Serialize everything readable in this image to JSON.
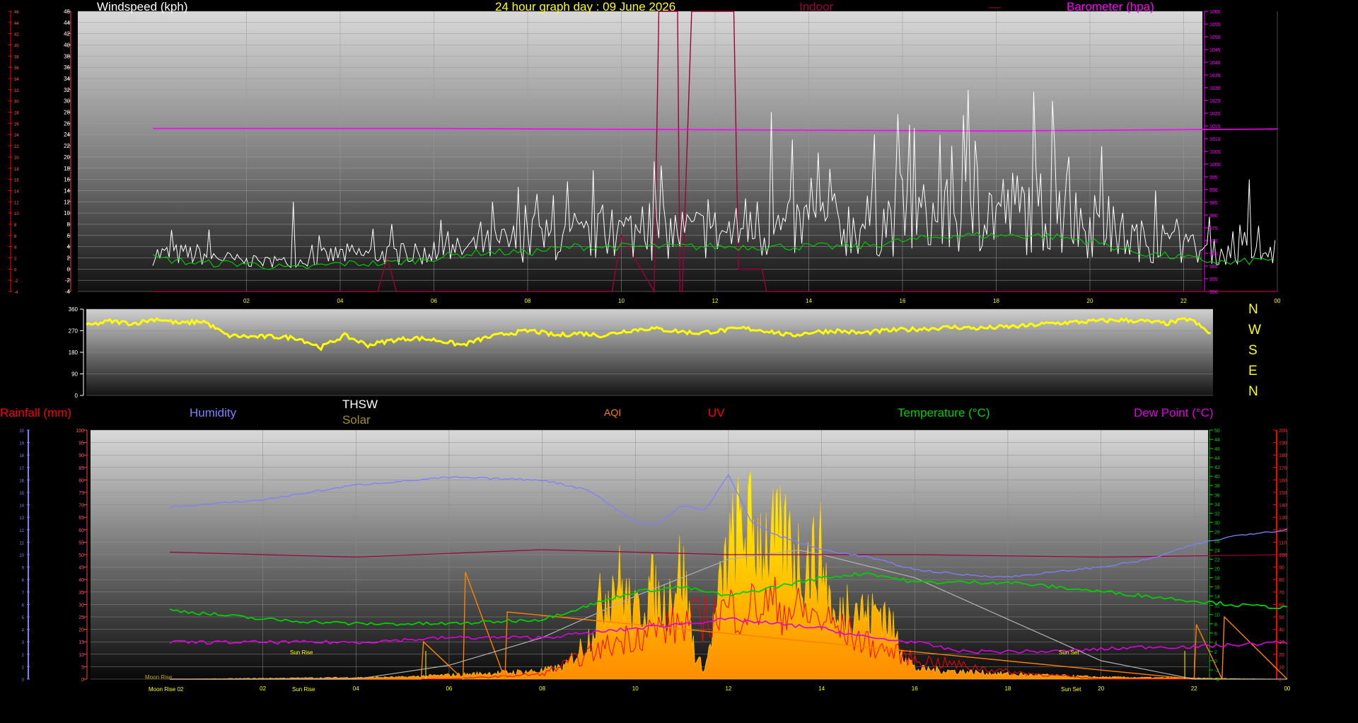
{
  "header": {
    "windspeed_label": "Windspeed (kph)",
    "title": "24 hour graph day : 09 June 2026",
    "indoor_label": "Indoor",
    "indoor_legend_mark": "—",
    "barometer_label": "Barometer (hpa)"
  },
  "direction_compass": [
    "N",
    "W",
    "S",
    "E",
    "N"
  ],
  "legend": {
    "rainfall": "Rainfall (mm)",
    "humidity": "Humidity",
    "thsw": "THSW",
    "solar": "Solar",
    "aqi": "AQI",
    "uv": "UV",
    "temperature": "Temperature (°C)",
    "dew_point": "Dew Point (°C)"
  },
  "annotations": {
    "moon_rise_axis": "Moon Rise 02",
    "moon_rise_plot": "Moon Rise",
    "sun_rise_axis": "Sun Rise",
    "sun_rise_plot": "Sun Rise",
    "sun_set_axis": "Sun Set",
    "sun_set_plot": "Sun Set"
  },
  "colors": {
    "windspeed": "#ffffff",
    "wind_avg": "#00c800",
    "barometer": "#ff00ff",
    "indoor": "#a0003c",
    "direction": "#ffff00",
    "humidity": "#7f7fff",
    "temperature": "#00d000",
    "dew_point": "#e000e0",
    "solar": "#ffd700",
    "uv": "#ff0000",
    "aqi": "#ff8000",
    "rainfall": "#ff0000",
    "thsw": "#b0b0b0"
  },
  "chart_data": [
    {
      "type": "line",
      "panel": "wind",
      "x_ticks": [
        "02",
        "04",
        "06",
        "08",
        "10",
        "12",
        "14",
        "16",
        "18",
        "20",
        "22",
        "00"
      ],
      "left_axis": {
        "label": "Windspeed (kph)",
        "ylim": [
          -4,
          46
        ],
        "ticks": [
          "-4",
          "-2",
          "0",
          "2",
          "4",
          "6",
          "8",
          "10",
          "12",
          "14",
          "16",
          "18",
          "20",
          "22",
          "24",
          "26",
          "28",
          "30",
          "32",
          "34",
          "36",
          "38",
          "40",
          "42",
          "44",
          "46"
        ]
      },
      "right_axis": {
        "label": "Barometer (hpa)",
        "ylim": [
          950,
          1060
        ],
        "ticks": [
          "950",
          "955",
          "960",
          "965",
          "970",
          "975",
          "980",
          "985",
          "990",
          "995",
          "1000",
          "1005",
          "1010",
          "1015",
          "1020",
          "1025",
          "1030",
          "1035",
          "1040",
          "1045",
          "1050",
          "1055",
          "1060"
        ]
      },
      "series": [
        {
          "name": "Windspeed (kph)",
          "color": "#ffffff",
          "x": [
            0,
            1,
            2,
            3,
            4,
            5,
            6,
            7,
            8,
            9,
            10,
            11,
            12,
            13,
            14,
            15,
            16,
            17,
            18,
            19,
            20,
            21,
            22,
            23,
            24
          ],
          "y": [
            4,
            4,
            2,
            2,
            4,
            4,
            4,
            6,
            8,
            8,
            10,
            10,
            10,
            10,
            12,
            12,
            14,
            14,
            16,
            16,
            12,
            8,
            6,
            4,
            4
          ],
          "peaks": [
            [
              3.0,
              12
            ],
            [
              9.0,
              10
            ],
            [
              13.2,
              28
            ],
            [
              15.4,
              24
            ],
            [
              17.4,
              32
            ],
            [
              19.2,
              30
            ],
            [
              21.4,
              14
            ],
            [
              23.4,
              16
            ]
          ]
        },
        {
          "name": "Wind average",
          "color": "#00c800",
          "x": [
            0,
            1,
            2,
            3,
            4,
            5,
            6,
            7,
            8,
            9,
            10,
            11,
            12,
            13,
            14,
            15,
            16,
            17,
            18,
            19,
            20,
            21,
            22,
            23,
            24
          ],
          "y": [
            2,
            1,
            1,
            0,
            1,
            1,
            2,
            3,
            3,
            4,
            4,
            4,
            4,
            4,
            4,
            4,
            5,
            6,
            6,
            6,
            5,
            3,
            2,
            1,
            2
          ]
        },
        {
          "name": "Barometer (hpa)",
          "axis": "right",
          "color": "#ff00ff",
          "x": [
            0,
            6,
            12,
            18,
            24
          ],
          "y": [
            1014,
            1014,
            1013.5,
            1013,
            1013.8
          ]
        },
        {
          "name": "Indoor",
          "color": "#a0003c",
          "x": [
            0,
            4.8,
            5.0,
            5.2,
            9.8,
            10.0,
            10.7,
            10.8,
            11.2,
            11.25,
            11.3,
            11.5,
            12.4,
            12.5,
            13.0,
            13.1,
            24
          ],
          "y": [
            -4,
            -4,
            2,
            -4,
            -4,
            6,
            -4,
            46,
            46,
            -4,
            -4,
            46,
            46,
            0,
            0,
            -4,
            -4
          ]
        }
      ]
    },
    {
      "type": "line",
      "panel": "direction",
      "ylim": [
        0,
        360
      ],
      "y_ticks": [
        "0",
        "90",
        "180",
        "270",
        "360"
      ],
      "series": [
        {
          "name": "Wind direction",
          "color": "#ffff00",
          "x": [
            0,
            0.5,
            1,
            1.5,
            2,
            2.5,
            3,
            3.5,
            4,
            4.5,
            5,
            5.5,
            6,
            6.5,
            7,
            7.5,
            8,
            8.5,
            9,
            9.5,
            10,
            10.5,
            11,
            11.5,
            12,
            12.5,
            13,
            13.5,
            14,
            14.5,
            15,
            15.5,
            16,
            16.5,
            17,
            17.5,
            18,
            18.5,
            19,
            19.5,
            20,
            20.5,
            21,
            21.5,
            22,
            22.5,
            23,
            23.5,
            24
          ],
          "y": [
            290,
            310,
            300,
            320,
            300,
            310,
            250,
            245,
            245,
            240,
            200,
            250,
            210,
            230,
            240,
            230,
            210,
            240,
            260,
            270,
            250,
            260,
            250,
            270,
            280,
            270,
            260,
            270,
            280,
            270,
            250,
            265,
            270,
            260,
            270,
            275,
            280,
            285,
            280,
            285,
            290,
            300,
            305,
            310,
            315,
            310,
            300,
            320,
            250
          ]
        }
      ]
    },
    {
      "type": "area",
      "panel": "environment",
      "x_ticks": [
        "02",
        "04",
        "06",
        "08",
        "10",
        "12",
        "14",
        "16",
        "18",
        "20",
        "22",
        "00"
      ],
      "left_axis": {
        "ylim": [
          0,
          100
        ],
        "ticks": [
          "0",
          "5",
          "10",
          "15",
          "20",
          "25",
          "30",
          "35",
          "40",
          "45",
          "50",
          "55",
          "60",
          "65",
          "70",
          "75",
          "80",
          "85",
          "90",
          "95",
          "100"
        ]
      },
      "rain_axis": {
        "ticks": [
          "0",
          "1",
          "2",
          "3",
          "4",
          "5",
          "6",
          "7",
          "8",
          "9",
          "10",
          "11",
          "12",
          "13",
          "14",
          "15",
          "16",
          "17",
          "18",
          "19",
          "20"
        ]
      },
      "temp_axis": {
        "ylim": [
          -4,
          50
        ],
        "ticks": [
          "-4",
          "-2",
          "0",
          "2",
          "4",
          "6",
          "8",
          "10",
          "12",
          "14",
          "16",
          "18",
          "20",
          "22",
          "24",
          "26",
          "28",
          "30",
          "32",
          "34",
          "36",
          "38",
          "40",
          "42",
          "44",
          "46",
          "48",
          "50"
        ]
      },
      "solar_axis": {
        "ylim": [
          0,
          200
        ],
        "ticks": [
          "0",
          "10",
          "20",
          "30",
          "40",
          "50",
          "60",
          "70",
          "80",
          "90",
          "100",
          "110",
          "120",
          "130",
          "140",
          "150",
          "160",
          "170",
          "180",
          "190",
          "200"
        ]
      },
      "series": [
        {
          "name": "Humidity",
          "color": "#7f7fff",
          "x": [
            0,
            2,
            4,
            6,
            8,
            9,
            10,
            10.5,
            11,
            11.5,
            12,
            12.5,
            13,
            14,
            15,
            16,
            17,
            18,
            19,
            20,
            21,
            22,
            23,
            24
          ],
          "y": [
            69,
            72,
            78,
            81,
            80,
            76,
            63,
            62,
            70,
            68,
            82,
            63,
            58,
            52,
            49,
            44,
            42,
            41,
            43,
            45,
            48,
            54,
            58,
            60
          ]
        },
        {
          "name": "Temperature (°C)",
          "color": "#00d000",
          "x": [
            0,
            2,
            4,
            6,
            8,
            9,
            10,
            11,
            12,
            13,
            14,
            15,
            16,
            17,
            18,
            19,
            20,
            21,
            22,
            23,
            24
          ],
          "y": [
            11,
            9,
            8,
            8,
            9,
            12,
            15,
            16,
            14,
            16,
            18,
            19,
            17,
            17,
            17,
            16,
            15,
            14,
            13,
            12,
            11.5
          ]
        },
        {
          "name": "Dew Point (°C)",
          "color": "#e000e0",
          "x": [
            0,
            2,
            4,
            6,
            8,
            9,
            10,
            11,
            12,
            13,
            14,
            15,
            16,
            17,
            18,
            19,
            20,
            21,
            22,
            23,
            24
          ],
          "y": [
            4,
            4,
            4,
            5,
            5,
            6,
            7,
            8,
            9,
            8,
            7,
            5,
            4,
            2,
            2,
            2,
            2.5,
            3,
            3,
            3.5,
            4
          ]
        },
        {
          "name": "THSW",
          "color": "#b0b0b0",
          "x": [
            0,
            2,
            4,
            6,
            8,
            10,
            12,
            13.5,
            14,
            16,
            18,
            20,
            22,
            24
          ],
          "y": [
            -4,
            -4,
            -4,
            -1,
            5,
            14,
            22,
            24,
            23,
            18,
            9,
            0,
            -4,
            -4
          ]
        },
        {
          "name": "Indoor",
          "color": "#a0003c",
          "x": [
            0,
            4,
            8,
            12,
            16,
            20,
            24
          ],
          "y": [
            51,
            49,
            52,
            50,
            50,
            49,
            50
          ]
        },
        {
          "name": "Solar",
          "color": "#ffd700",
          "x": [
            0,
            5,
            6,
            7,
            8,
            8.5,
            9,
            9.3,
            9.6,
            10,
            10.3,
            10.6,
            11,
            11.3,
            11.5,
            11.8,
            12,
            12.3,
            12.6,
            13,
            13.3,
            13.6,
            14,
            14.3,
            14.6,
            15,
            15.3,
            15.6,
            16,
            18,
            20,
            24
          ],
          "y": [
            0,
            2,
            4,
            6,
            8,
            12,
            40,
            80,
            100,
            60,
            90,
            70,
            110,
            20,
            10,
            80,
            120,
            150,
            140,
            130,
            130,
            110,
            120,
            50,
            80,
            60,
            70,
            40,
            10,
            5,
            2,
            0
          ]
        },
        {
          "name": "UV",
          "color": "#ff0000",
          "x": [
            0,
            6,
            8,
            9,
            10,
            11,
            12,
            13,
            14,
            15,
            16,
            18,
            20,
            24
          ],
          "y": [
            0,
            0,
            2,
            10,
            18,
            22,
            28,
            30,
            24,
            14,
            8,
            3,
            0,
            0
          ]
        },
        {
          "name": "AQI",
          "color": "#ff8000",
          "x": [
            0,
            5.4,
            5.45,
            6.3,
            6.35,
            7.2,
            7.25,
            22,
            22.05,
            22.6,
            22.65,
            24
          ],
          "y": [
            0,
            0,
            15,
            0,
            43,
            0,
            27,
            0,
            22,
            0,
            25,
            0
          ]
        }
      ]
    }
  ]
}
